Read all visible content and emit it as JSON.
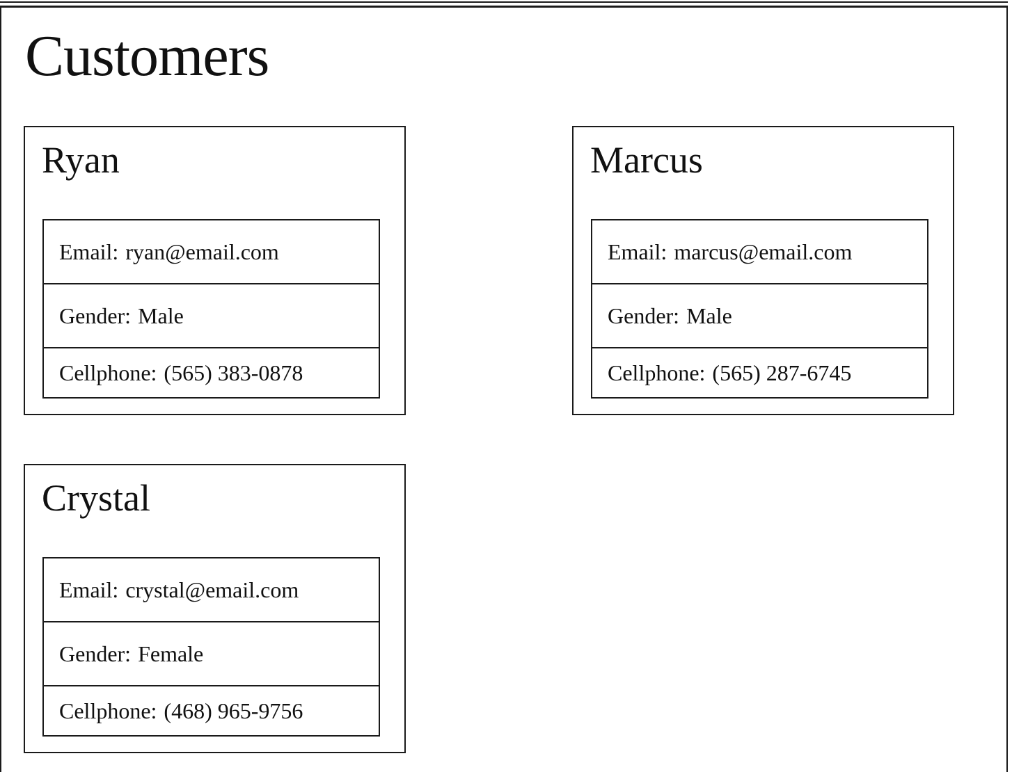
{
  "page": {
    "title": "Customers"
  },
  "customers": [
    {
      "name": "Ryan",
      "email_label": "Email:",
      "email": "ryan@email.com",
      "gender_label": "Gender:",
      "gender": "Male",
      "phone_label": "Cellphone:",
      "phone": "(565) 383-0878"
    },
    {
      "name": "Marcus",
      "email_label": "Email:",
      "email": "marcus@email.com",
      "gender_label": "Gender:",
      "gender": "Male",
      "phone_label": "Cellphone:",
      "phone": "(565) 287-6745"
    },
    {
      "name": "Crystal",
      "email_label": "Email:",
      "email": "crystal@email.com",
      "gender_label": "Gender:",
      "gender": "Female",
      "phone_label": "Cellphone:",
      "phone": "(468) 965-9756"
    }
  ],
  "colors": {
    "border": "#1a1a1a",
    "text": "#111111",
    "background": "#ffffff"
  }
}
